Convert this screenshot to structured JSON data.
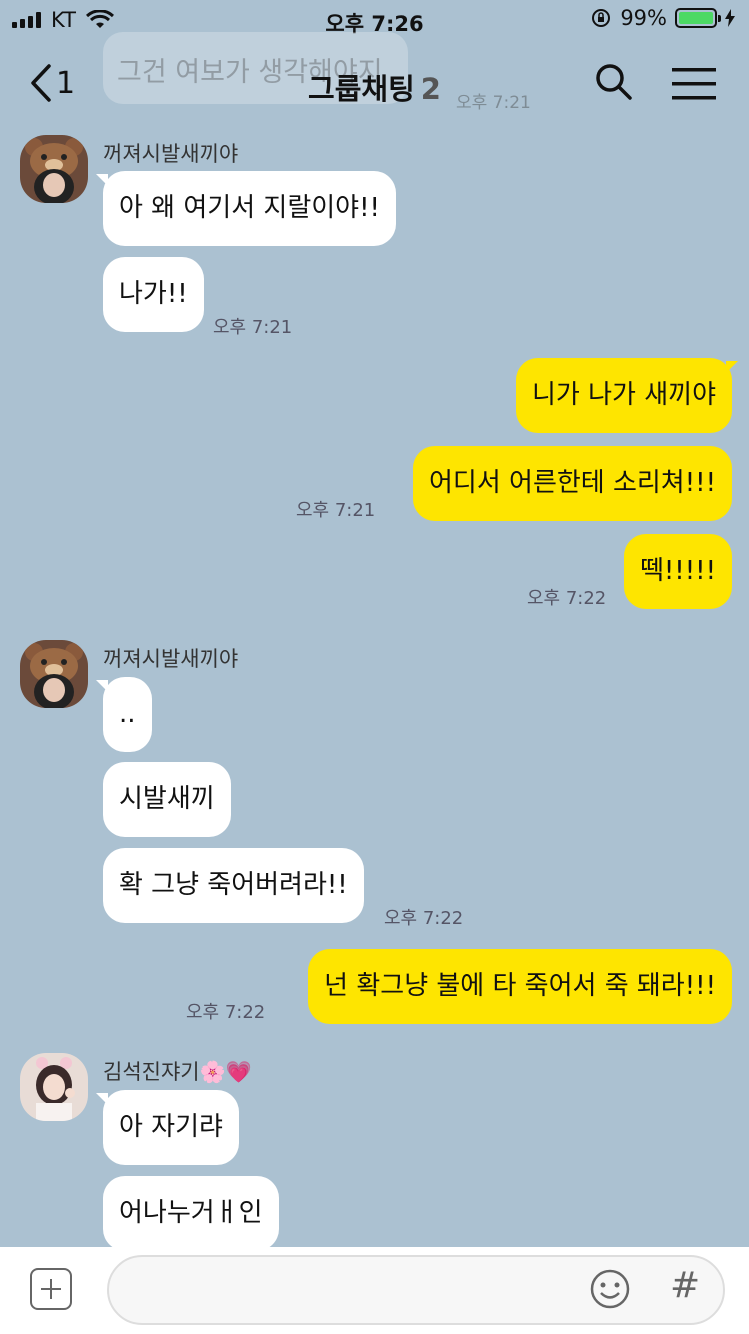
{
  "status_bar": {
    "carrier": "KT",
    "time": "오후 7:26",
    "battery_pct": "99%",
    "battery_level": 0.99
  },
  "header": {
    "back_count": "1",
    "title": "그룹채팅",
    "member_count": "2"
  },
  "ghost_message": {
    "text": "그건 여보가 생각해야지",
    "time": "오후 7:21"
  },
  "messages": [
    {
      "id": 1,
      "side": "in",
      "sender": "꺼져시발새끼야",
      "text": "아 왜 여기서 지랄이야!!"
    },
    {
      "id": 2,
      "side": "in",
      "text": "나가!!",
      "time": "오후 7:21"
    },
    {
      "id": 3,
      "side": "out",
      "text": "니가 나가 새끼야"
    },
    {
      "id": 4,
      "side": "out",
      "text": "어디서 어른한테 소리쳐!!!",
      "time": "오후 7:21"
    },
    {
      "id": 5,
      "side": "out",
      "text": "떽!!!!!",
      "time": "오후 7:22"
    },
    {
      "id": 6,
      "side": "in",
      "sender": "꺼져시발새끼야",
      "text": ".."
    },
    {
      "id": 7,
      "side": "in",
      "text": "시발새끼"
    },
    {
      "id": 8,
      "side": "in",
      "text": "확 그냥 죽어버려라!!",
      "time": "오후 7:22"
    },
    {
      "id": 9,
      "side": "out",
      "text": "넌 확그냥 불에 타 죽어서 죽 돼라!!!",
      "time": "오후 7:22"
    },
    {
      "id": 10,
      "side": "in",
      "sender": "김석진쟈기🌸💗",
      "text": "아 자기랴"
    },
    {
      "id": 11,
      "side": "in",
      "text": "어나누거ㅐ인"
    }
  ],
  "input": {
    "placeholder": ""
  },
  "colors": {
    "background": "#abc1d1",
    "my_bubble": "#fee500",
    "other_bubble": "#ffffff"
  },
  "icons": [
    "back-chevron-icon",
    "search-icon",
    "menu-icon",
    "plus-icon",
    "emoji-icon",
    "hash-icon"
  ]
}
